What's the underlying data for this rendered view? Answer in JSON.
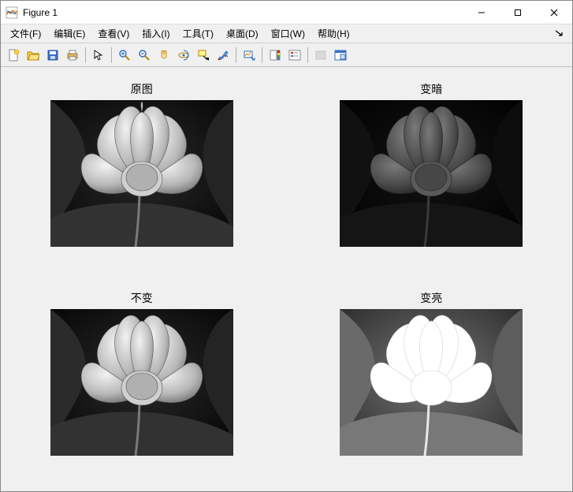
{
  "window": {
    "title": "Figure 1"
  },
  "menubar": {
    "items": [
      "文件(F)",
      "编辑(E)",
      "查看(V)",
      "插入(I)",
      "工具(T)",
      "桌面(D)",
      "窗口(W)",
      "帮助(H)"
    ]
  },
  "toolbar": {
    "groups": [
      [
        "new",
        "open",
        "save",
        "print"
      ],
      [
        "pointer"
      ],
      [
        "zoom-in",
        "zoom-out",
        "pan",
        "rotate3d",
        "datacursor",
        "brush"
      ],
      [
        "link"
      ],
      [
        "colorbar",
        "legend"
      ],
      [
        "hide",
        "dock"
      ]
    ]
  },
  "subplots": [
    {
      "title": "原图",
      "effect": "original"
    },
    {
      "title": "变暗",
      "effect": "darker"
    },
    {
      "title": "不变",
      "effect": "unchanged"
    },
    {
      "title": "变亮",
      "effect": "brighter"
    }
  ]
}
